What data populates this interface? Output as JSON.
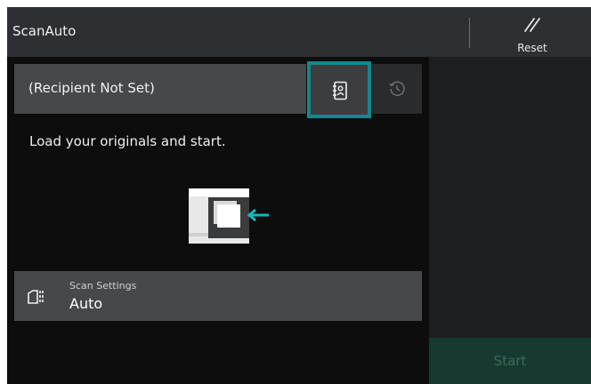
{
  "header": {
    "title": "ScanAuto",
    "reset_label": "Reset",
    "reset_icon": "reset-slash-icon"
  },
  "recipient": {
    "text": "(Recipient Not Set)",
    "address_book_icon": "address-book-icon",
    "history_icon": "history-icon"
  },
  "instruction": "Load your originals and start.",
  "scan_settings": {
    "label": "Scan Settings",
    "value": "Auto",
    "icon": "scan-settings-icon"
  },
  "start": {
    "label": "Start"
  },
  "colors": {
    "accent": "#14878e",
    "panel": "#46484b",
    "background": "#0d0d0d",
    "start_disabled": "#173a30"
  }
}
